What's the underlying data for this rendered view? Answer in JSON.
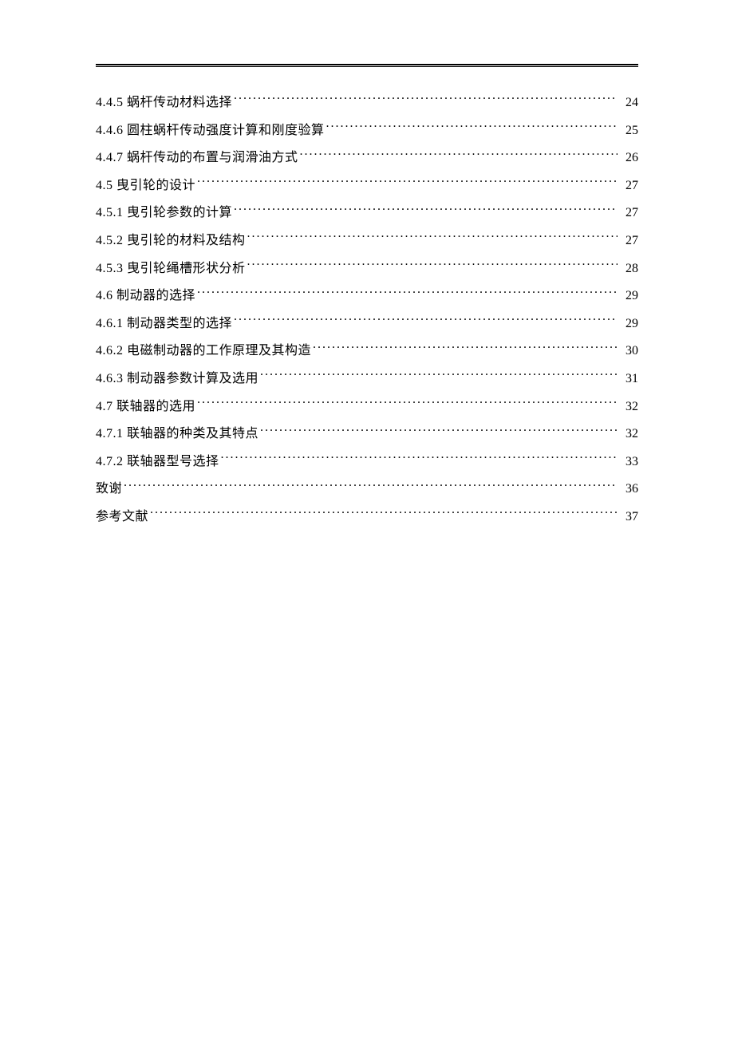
{
  "toc": [
    {
      "title": "4.4.5 蜗杆传动材料选择",
      "page": "24"
    },
    {
      "title": "4.4.6 圆柱蜗杆传动强度计算和刚度验算",
      "page": "25"
    },
    {
      "title": "4.4.7 蜗杆传动的布置与润滑油方式",
      "page": "26"
    },
    {
      "title": "4.5 曳引轮的设计",
      "page": "27"
    },
    {
      "title": "4.5.1 曳引轮参数的计算",
      "page": "27"
    },
    {
      "title": "4.5.2 曳引轮的材料及结构",
      "page": "27"
    },
    {
      "title": "4.5.3 曳引轮绳槽形状分析",
      "page": "28"
    },
    {
      "title": "4.6 制动器的选择",
      "page": "29"
    },
    {
      "title": "4.6.1 制动器类型的选择",
      "page": "29"
    },
    {
      "title": "4.6.2 电磁制动器的工作原理及其构造",
      "page": "30"
    },
    {
      "title": "4.6.3 制动器参数计算及选用",
      "page": "31"
    },
    {
      "title": "4.7 联轴器的选用",
      "page": "32"
    },
    {
      "title": "4.7.1 联轴器的种类及其特点",
      "page": "32"
    },
    {
      "title": "4.7.2 联轴器型号选择",
      "page": "33"
    },
    {
      "title": "致谢",
      "page": "36"
    },
    {
      "title": "参考文献",
      "page": "37"
    }
  ]
}
